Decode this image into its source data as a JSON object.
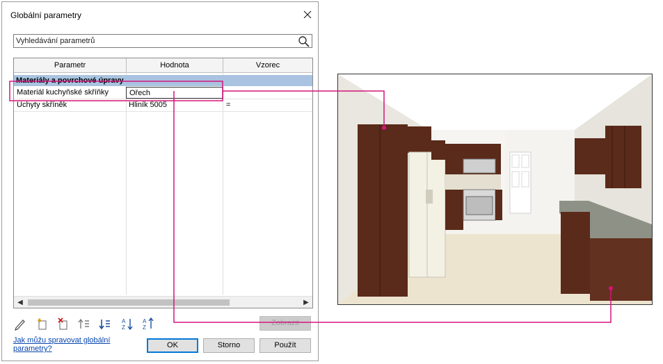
{
  "dialog": {
    "title": "Globální parametry",
    "search_placeholder": "Vyhledávání parametrů",
    "columns": [
      "Parametr",
      "Hodnota",
      "Vzorec"
    ],
    "group": "Materiály a povrchové úpravy",
    "rows": [
      {
        "param": "Materiál kuchyňské skříňky",
        "value": "Ořech",
        "formula": ""
      },
      {
        "param": "Úchyty skříněk",
        "value": "Hliník 5005",
        "formula": "="
      }
    ],
    "show_label": "Zobrazit",
    "help_link": "Jak můžu spravovat globální parametry?",
    "ok_label": "OK",
    "cancel_label": "Storno",
    "apply_label": "Použít"
  },
  "icons": [
    "close-icon",
    "search-icon",
    "edit-icon",
    "new-parameter-icon",
    "delete-parameter-icon",
    "move-up-icon",
    "move-down-icon",
    "sort-ascending-icon",
    "sort-descending-icon"
  ],
  "colors": {
    "callout": "#d6147c",
    "group_header": "#a9c3e0",
    "wood": "#5a2a1a",
    "counter": "#8e9186",
    "floor": "#ece4cf"
  }
}
